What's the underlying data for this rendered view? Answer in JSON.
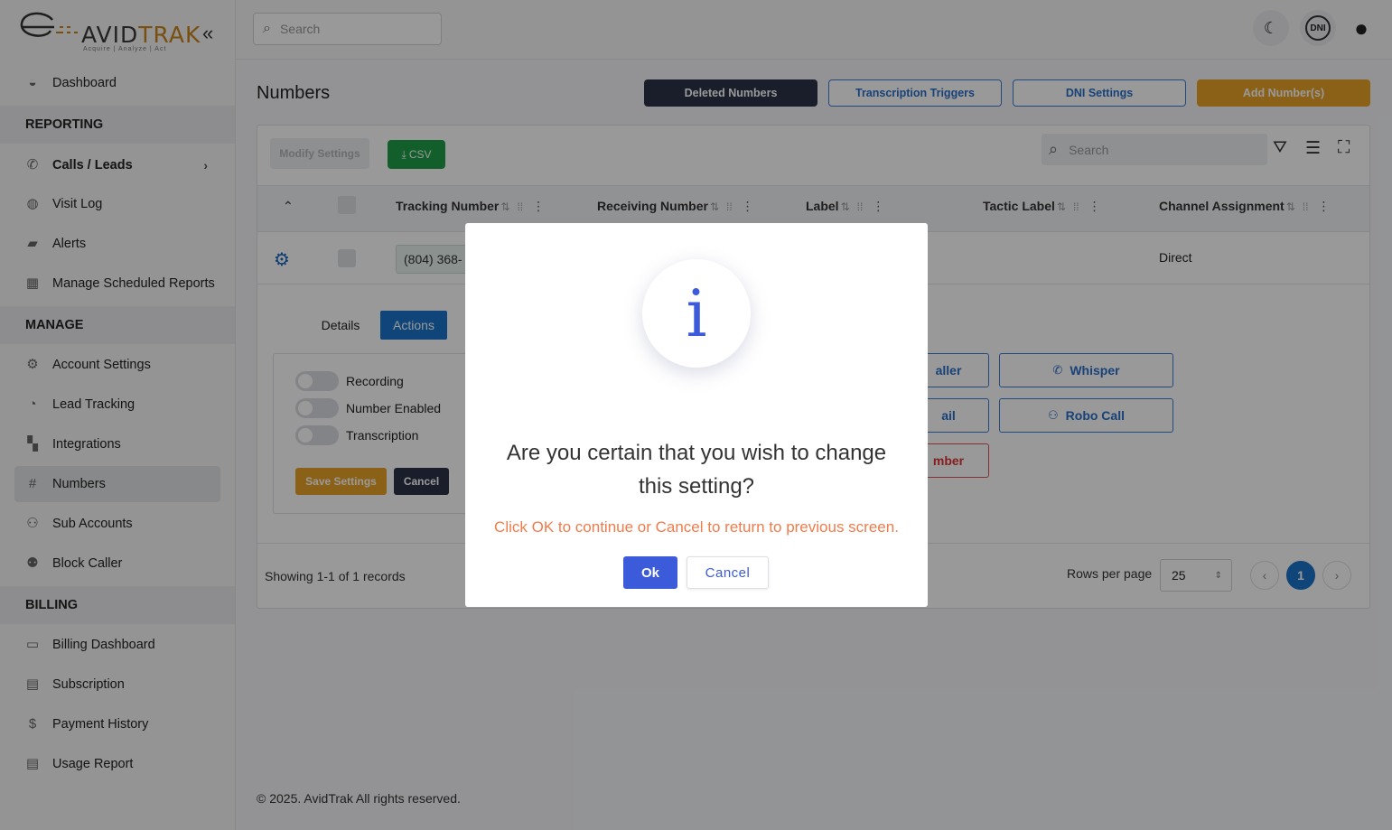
{
  "app": {
    "logo_main": "AVID",
    "logo_accent": "TRAK",
    "logo_tagline": "Acquire  |  Analyze  |  Act"
  },
  "sidebar": {
    "items_top": [
      {
        "label": "Dashboard",
        "icon": "dashboard-icon"
      }
    ],
    "sections": [
      {
        "title": "REPORTING",
        "items": [
          {
            "label": "Calls / Leads",
            "icon": "phone-icon"
          },
          {
            "label": "Visit Log",
            "icon": "globe-icon"
          },
          {
            "label": "Alerts",
            "icon": "chat-icon"
          },
          {
            "label": "Manage Scheduled Reports",
            "icon": "calendar-icon"
          }
        ]
      },
      {
        "title": "MANAGE",
        "items": [
          {
            "label": "Account Settings",
            "icon": "gear-icon"
          },
          {
            "label": "Lead Tracking",
            "icon": "pie-chart-icon"
          },
          {
            "label": "Integrations",
            "icon": "grid-icon"
          },
          {
            "label": "Numbers",
            "icon": "hash-icon"
          },
          {
            "label": "Sub Accounts",
            "icon": "users-icon"
          },
          {
            "label": "Block Caller",
            "icon": "user-block-icon"
          }
        ]
      },
      {
        "title": "BILLING",
        "items": [
          {
            "label": "Billing Dashboard",
            "icon": "credit-card-icon"
          },
          {
            "label": "Subscription",
            "icon": "subscription-icon"
          },
          {
            "label": "Payment History",
            "icon": "dollar-icon"
          },
          {
            "label": "Usage Report",
            "icon": "report-icon"
          }
        ]
      }
    ]
  },
  "topbar": {
    "search_placeholder": "Search",
    "dni_label": "DNI"
  },
  "page": {
    "title": "Numbers",
    "buttons": {
      "deleted": "Deleted Numbers",
      "triggers": "Transcription Triggers",
      "dni": "DNI Settings",
      "add": "Add Number(s)"
    }
  },
  "table": {
    "modify_label": "Modify Settings",
    "csv_label": "CSV",
    "search_placeholder": "Search",
    "columns": [
      "Tracking Number",
      "Receiving Number",
      "Label",
      "Tactic Label",
      "Channel Assignment"
    ],
    "row": {
      "tracking": "(804) 368-",
      "channel": "Direct"
    },
    "tabs": {
      "details": "Details",
      "actions": "Actions"
    },
    "toggles": [
      "Recording",
      "Number Enabled",
      "Transcription"
    ],
    "save_label": "Save Settings",
    "cancel_label": "Cancel",
    "actions": {
      "caller": "aller",
      "whisper": "Whisper",
      "mail": "ail",
      "robo": "Robo Call",
      "number": "mber"
    },
    "showing": "Showing 1-1 of 1 records",
    "rows_per_page_label": "Rows per page",
    "rows_per_page": "25",
    "current_page": "1"
  },
  "footer": {
    "copyright": "© 2025. AvidTrak All rights reserved."
  },
  "modal": {
    "icon_glyph": "i",
    "title": "Are you certain that you wish to change this setting?",
    "text": "Click OK to continue or Cancel to return to previous screen.",
    "ok_label": "Ok",
    "cancel_label": "Cancel"
  }
}
